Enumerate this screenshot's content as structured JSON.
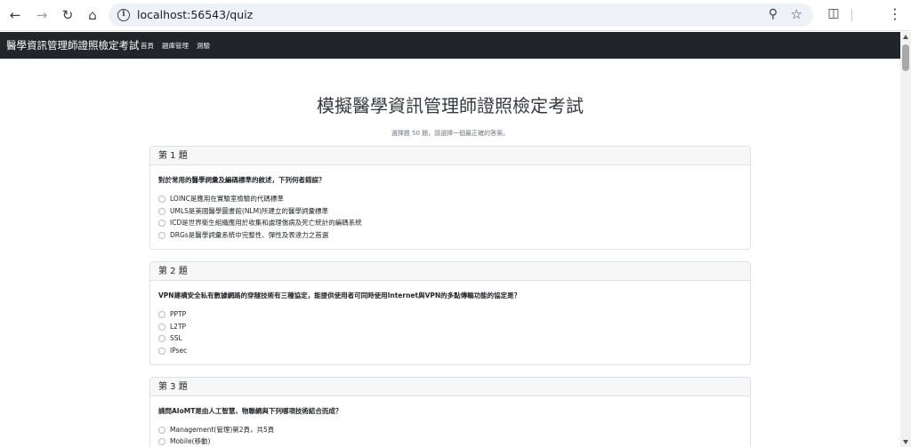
{
  "browser": {
    "url": "localhost:56543/quiz"
  },
  "navbar": {
    "brand": "醫學資訊管理師證照檢定考試",
    "links": [
      "首頁",
      "題庫管理",
      "測驗"
    ]
  },
  "page": {
    "title": "模擬醫學資訊管理師證照檢定考試",
    "subtitle": "選擇題 50 題，請選擇一個最正確的答案。"
  },
  "questions": [
    {
      "header": "第 1 題",
      "text": "對於常用的醫學詞彙及編碼標準的敘述，下列何者錯誤？",
      "options": [
        "LOINC是應用在實驗室檢驗的代碼標準",
        "UMLS是美國醫學圖書館(NLM)所建立的醫學詞彙標準",
        "ICD是世界衛生組織應用於收集和處理傷病及死亡統計的編碼系統",
        "DRGs是醫學詞彙系統中完整性、彈性及表達力之首選"
      ]
    },
    {
      "header": "第 2 題",
      "text": "VPN建構安全私有數據網路的穿隧技術有三種協定，能提供使用者可同時使用Internet與VPN的多點傳輸功能的協定是？",
      "options": [
        "PPTP",
        "L2TP",
        "SSL",
        "IPsec"
      ]
    },
    {
      "header": "第 3 題",
      "text": "請問AIoMT是由人工智慧、物聯網與下列哪項技術結合而成？",
      "options": [
        "Management(管理)第2頁，共5頁",
        "Mobile(移動)"
      ]
    }
  ]
}
